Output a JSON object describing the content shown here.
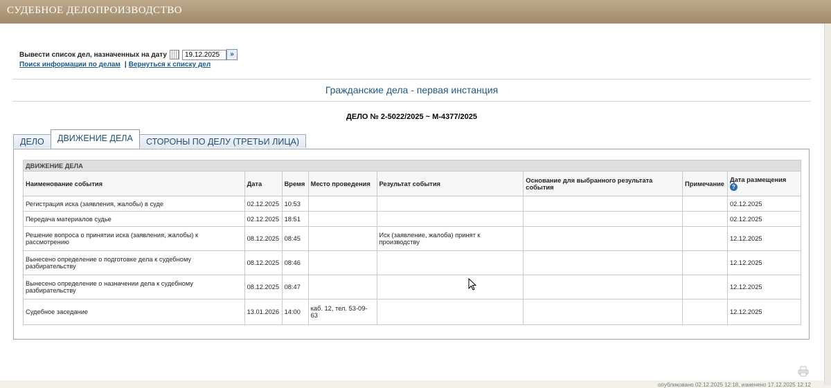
{
  "header": {
    "title": "СУДЕБНОЕ ДЕЛОПРОИЗВОДСТВО"
  },
  "date_filter": {
    "label": "Вывести список дел, назначенных на дату",
    "date_value": "19.12.2025",
    "calendar_icon": "calendar-icon",
    "go_icon": "double-chevron-right-icon"
  },
  "links": {
    "search": "Поиск информации по делам",
    "separator": "|",
    "back": "Вернуться к списку дел"
  },
  "section_title": "Гражданские дела - первая инстанция",
  "case_title": "ДЕЛО № 2-5022/2025 ~ М-4377/2025",
  "tabs": [
    {
      "label": "ДЕЛО",
      "active": false
    },
    {
      "label": "ДВИЖЕНИЕ ДЕЛА",
      "active": true
    },
    {
      "label": "СТОРОНЫ ПО ДЕЛУ (ТРЕТЬИ ЛИЦА)",
      "active": false
    }
  ],
  "movement": {
    "caption": "ДВИЖЕНИЕ ДЕЛА",
    "columns": [
      "Наименование события",
      "Дата",
      "Время",
      "Место проведения",
      "Результат события",
      "Основание для выбранного результата события",
      "Примечание",
      "Дата размещения"
    ],
    "help_icon": "question-mark-icon",
    "rows": [
      [
        "Регистрация иска (заявления, жалобы) в суде",
        "02.12.2025",
        "10:53",
        "",
        "",
        "",
        "",
        "02.12.2025"
      ],
      [
        "Передача материалов судье",
        "02.12.2025",
        "18:51",
        "",
        "",
        "",
        "",
        "02.12.2025"
      ],
      [
        "Решение вопроса о принятии иска (заявления, жалобы) к рассмотрению",
        "08.12.2025",
        "08:45",
        "",
        "Иск (заявление, жалоба) принят к производству",
        "",
        "",
        "12.12.2025"
      ],
      [
        "Вынесено определение о подготовке дела к судебному разбирательству",
        "08.12.2025",
        "08:46",
        "",
        "",
        "",
        "",
        "12.12.2025"
      ],
      [
        "Вынесено определение о назначении дела к судебному разбирательству",
        "08.12.2025",
        "08:47",
        "",
        "",
        "",
        "",
        "12.12.2025"
      ],
      [
        "Судебное заседание",
        "13.01.2026",
        "14:00",
        "каб. 12, тел. 53-09-63",
        "",
        "",
        "",
        "12.12.2025"
      ]
    ]
  },
  "footer": {
    "print_icon": "printer-icon",
    "note": "опубликовано 02.12.2025 12:18, изменено 17.12.2025 12:12"
  }
}
